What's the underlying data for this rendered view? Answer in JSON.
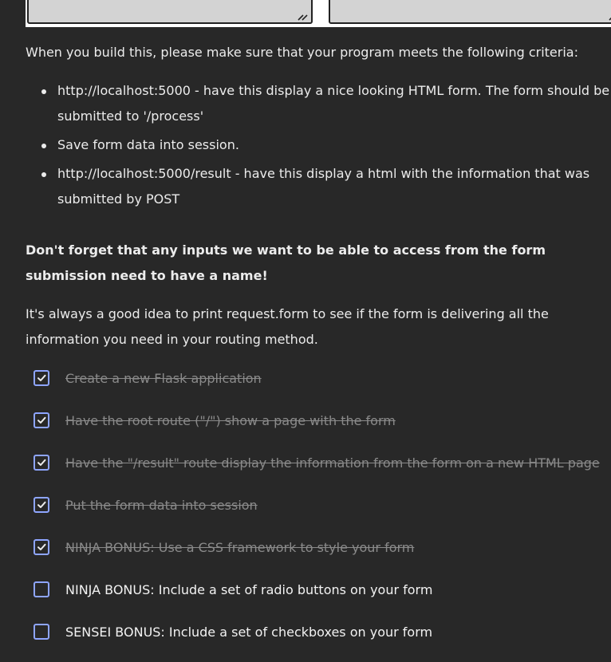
{
  "intro": "When you build this, please make sure that your program meets the following criteria:",
  "criteria": [
    {
      "line1": "http://localhost:5000 - have this display a nice looking HTML form.  The form should be",
      "line2": "submitted to '/process'"
    },
    {
      "line1": "Save form data into session.",
      "line2": ""
    },
    {
      "line1": "http://localhost:5000/result - have this display a html with the information that was",
      "line2": "submitted by POST"
    }
  ],
  "bold_note": "Don't forget that any inputs we want to be able to access from the form submission need to have a name!",
  "tip": "It's always a good idea to print request.form to see if the form is delivering all the information you need in your routing method.",
  "tasks": [
    {
      "label": "Create a new Flask application",
      "checked": true
    },
    {
      "label": "Have the root route (\"/\") show a page with the form",
      "checked": true
    },
    {
      "label": "Have the \"/result\" route display the information from the form on a new HTML page",
      "checked": true
    },
    {
      "label": "Put the form data into session",
      "checked": true
    },
    {
      "label": "NINJA BONUS: Use a CSS framework to style your form",
      "checked": true
    },
    {
      "label": "NINJA BONUS: Include a set of radio buttons on your form",
      "checked": false
    },
    {
      "label": "SENSEI BONUS: Include a set of checkboxes on your form",
      "checked": false
    }
  ],
  "colors": {
    "background": "#282828",
    "text": "#ececec",
    "checkbox_border": "#8ea5ff",
    "done_text": "#8a8a8a"
  },
  "icons": {
    "checked": "checkmark-icon",
    "resize": "resize-grip-icon"
  }
}
